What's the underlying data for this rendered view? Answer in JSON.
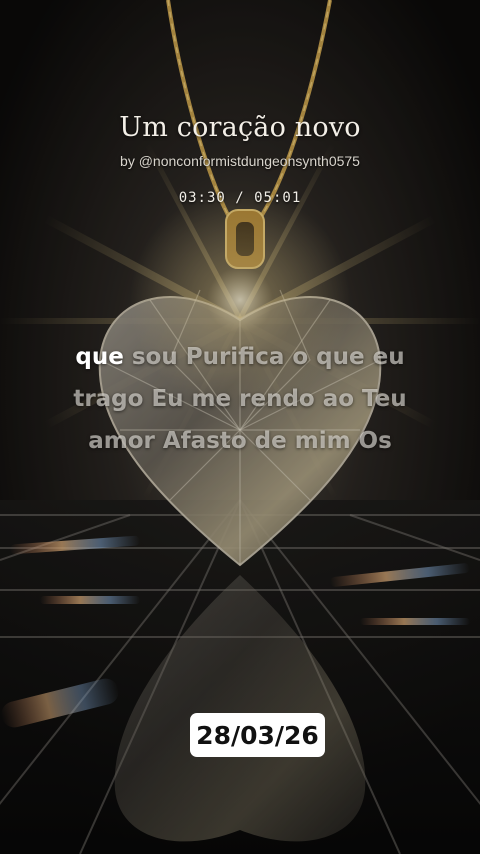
{
  "player": {
    "title": "Um coração novo",
    "artist": "by @nonconformistdungeonsynth0575",
    "time_display": "03:30 / 05:01",
    "progress_fraction": 0.6977
  },
  "lyrics": {
    "active_word": "que",
    "rest": " sou Purifica o que eu trago Eu me rendo ao Teu amor Afasto de mim Os"
  },
  "date_badge": "28/03/26",
  "background": {
    "image_subject": "diamond heart pendant on gold chain over reflective tiled floor with light flares",
    "colors": {
      "backdrop": "#0c0b0a",
      "gold": "#d9b35a",
      "crystal": "#cfc8b8"
    }
  }
}
